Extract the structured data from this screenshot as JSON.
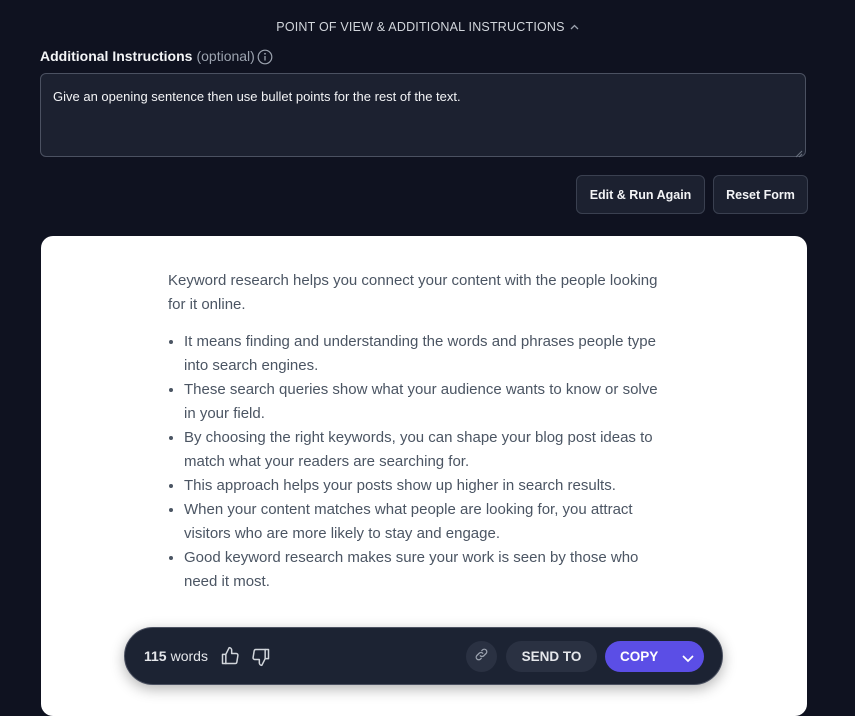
{
  "section": {
    "title": "POINT OF VIEW & ADDITIONAL INSTRUCTIONS"
  },
  "instructions": {
    "label": "Additional Instructions",
    "optional": "(optional)",
    "value": "Give an opening sentence then use bullet points for the rest of the text."
  },
  "buttons": {
    "edit_run": "Edit & Run Again",
    "reset": "Reset Form"
  },
  "output": {
    "intro": "Keyword research helps you connect your content with the people looking for it online.",
    "bullets": [
      "It means finding and understanding the words and phrases people type into search engines.",
      "These search queries show what your audience wants to know or solve in your field.",
      "By choosing the right keywords, you can shape your blog post ideas to match what your readers are searching for.",
      "This approach helps your posts show up higher in search results.",
      "When your content matches what people are looking for, you attract visitors who are more likely to stay and engage.",
      "Good keyword research makes sure your work is seen by those who need it most."
    ]
  },
  "action_bar": {
    "word_count": "115",
    "word_unit": "words",
    "send_to": "SEND TO",
    "copy": "COPY"
  },
  "colors": {
    "accent": "#5b4ee6",
    "background": "#0f1220",
    "card": "#ffffff"
  },
  "icons": [
    "chevron-up-icon",
    "info-icon",
    "thumbs-up-icon",
    "thumbs-down-icon",
    "link-icon",
    "chevron-down-icon"
  ]
}
